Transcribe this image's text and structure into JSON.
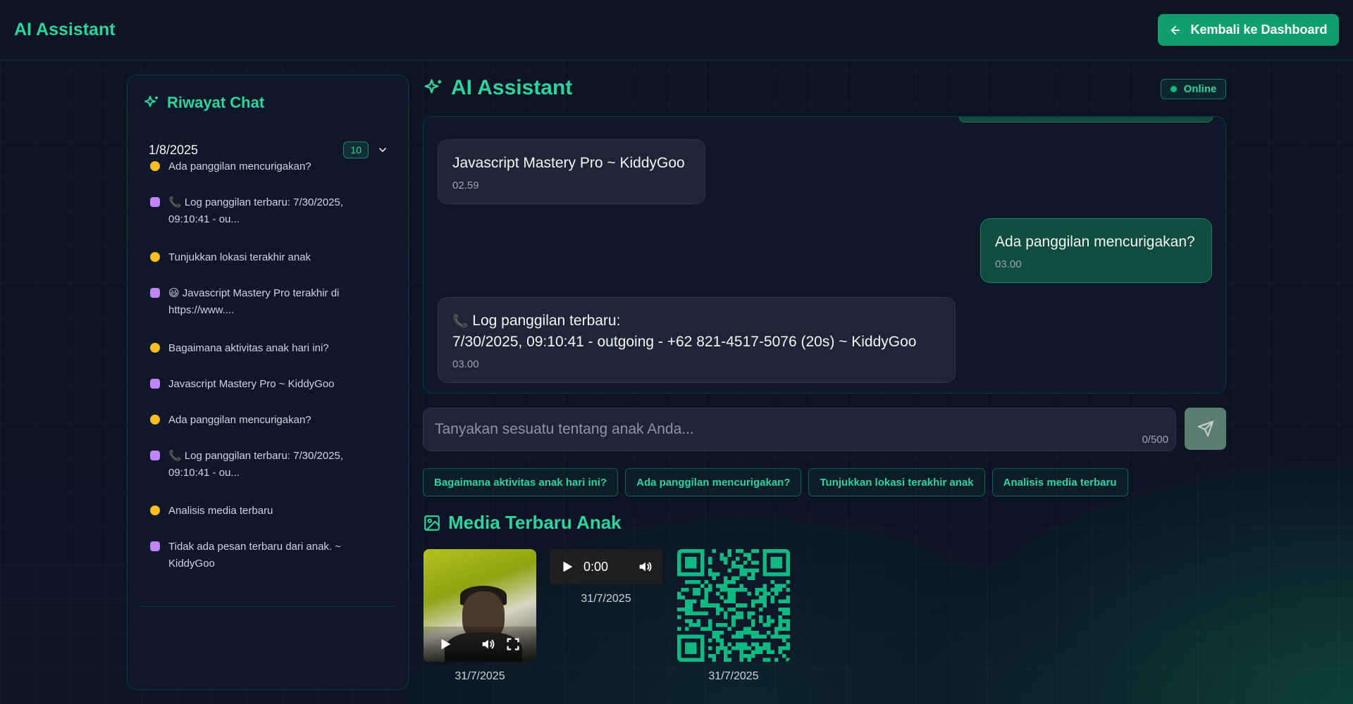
{
  "header": {
    "brand": "AI Assistant",
    "back_label": "Kembali ke Dashboard"
  },
  "sidebar": {
    "title": "Riwayat Chat",
    "group_date": "1/8/2025",
    "group_count": "10",
    "items": [
      {
        "role": "user",
        "text": "Ada panggilan mencurigakan?"
      },
      {
        "role": "bot",
        "text": "📞 Log panggilan terbaru: 7/30/2025, 09:10:41 - ou..."
      },
      {
        "role": "user",
        "text": "Tunjukkan lokasi terakhir anak"
      },
      {
        "role": "bot",
        "text": "😃 Javascript Mastery Pro terakhir di https://www...."
      },
      {
        "role": "user",
        "text": "Bagaimana aktivitas anak hari ini?"
      },
      {
        "role": "bot",
        "text": "Javascript Mastery Pro ~ KiddyGoo"
      },
      {
        "role": "user",
        "text": "Ada panggilan mencurigakan?"
      },
      {
        "role": "bot",
        "text": "📞 Log panggilan terbaru: 7/30/2025, 09:10:41 - ou..."
      },
      {
        "role": "user",
        "text": "Analisis media terbaru"
      },
      {
        "role": "bot",
        "text": "Tidak ada pesan terbaru dari anak. ~ KiddyGoo"
      }
    ]
  },
  "chat": {
    "title": "AI Assistant",
    "status": "Online",
    "messages": [
      {
        "role": "bot",
        "text": "Javascript Mastery Pro ~ KiddyGoo",
        "time": "02.59"
      },
      {
        "role": "user",
        "text": "Ada panggilan mencurigakan?",
        "time": "03.00"
      },
      {
        "role": "bot",
        "line1": "Log panggilan terbaru:",
        "line2": "7/30/2025, 09:10:41 - outgoing - +62 821-4517-5076 (20s) ~ KiddyGoo",
        "time": "03.00"
      }
    ]
  },
  "input": {
    "placeholder": "Tanyakan sesuatu tentang anak Anda...",
    "value": "",
    "counter": "0/500"
  },
  "suggestions": [
    "Bagaimana aktivitas anak hari ini?",
    "Ada panggilan mencurigakan?",
    "Tunjukkan lokasi terakhir anak",
    "Analisis media terbaru"
  ],
  "media": {
    "title": "Media Terbaru Anak",
    "items": [
      {
        "type": "video",
        "date": "31/7/2025"
      },
      {
        "type": "audio",
        "time": "0:00",
        "date": "31/7/2025"
      },
      {
        "type": "image-qr",
        "date": "31/7/2025"
      }
    ]
  },
  "colors": {
    "accent": "#2dd4a0",
    "button": "#0f9f6e",
    "background": "#0b1220"
  }
}
